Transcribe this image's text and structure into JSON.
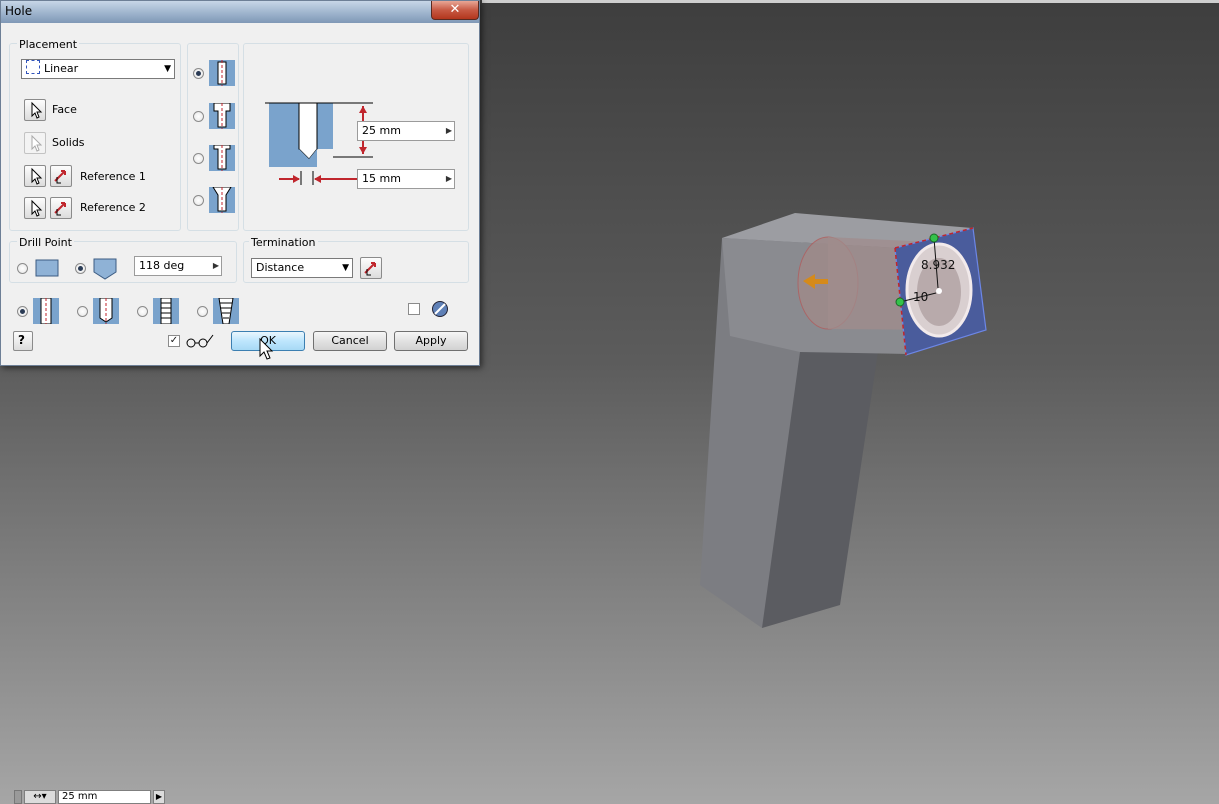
{
  "dialog": {
    "title": "Hole",
    "close_glyph": "✕",
    "placement": {
      "group_label": "Placement",
      "type_value": "Linear",
      "face_label": "Face",
      "solids_label": "Solids",
      "ref1_label": "Reference 1",
      "ref2_label": "Reference 2"
    },
    "hole_types": [
      "drilled",
      "counterbore",
      "spotface",
      "countersink"
    ],
    "selected_hole_type": 0,
    "depth_value": "25 mm",
    "diameter_value": "15 mm",
    "drill_point": {
      "group_label": "Drill Point",
      "angle_value": "118 deg",
      "options": [
        "flat",
        "angle"
      ],
      "selected": 1
    },
    "termination": {
      "group_label": "Termination",
      "value": "Distance"
    },
    "thread_types": [
      "simple-hole",
      "clearance-hole",
      "tapped-hole",
      "taper-tapped-hole"
    ],
    "selected_thread_type": 0,
    "preview_checked": true,
    "buttons": {
      "help": "?",
      "ok": "OK",
      "cancel": "Cancel",
      "apply": "Apply"
    }
  },
  "viewport": {
    "dimension_1": "8.932",
    "dimension_2": "10",
    "accent_blue": "#4a5c9c",
    "face_red": "#c0262d"
  },
  "mini_toolbar": {
    "value": "25 mm"
  }
}
